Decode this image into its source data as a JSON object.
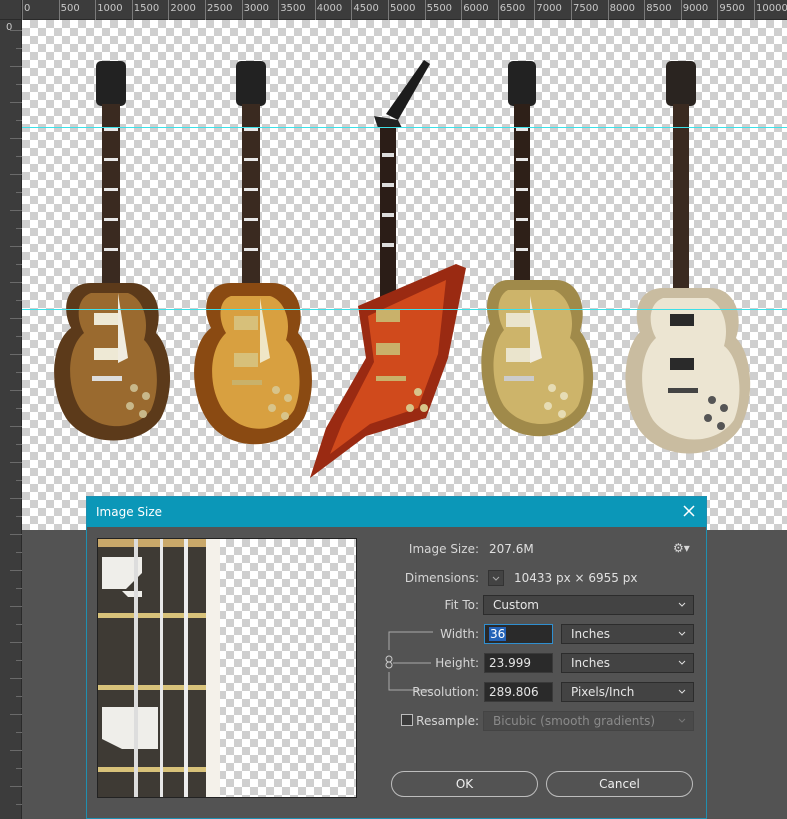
{
  "ruler": {
    "top_labels": [
      "0",
      "500",
      "1000",
      "1500",
      "2000",
      "2500",
      "3000",
      "3500",
      "4000",
      "4500",
      "5000",
      "5500",
      "6000",
      "6500",
      "7000",
      "7500",
      "8000",
      "8500",
      "9000",
      "9500",
      "10000"
    ],
    "left_origin": "0"
  },
  "dialog": {
    "title": "Image Size",
    "image_size_label": "Image Size:",
    "image_size_value": "207.6M",
    "dimensions_label": "Dimensions:",
    "dimensions_value": "10433 px  ×  6955 px",
    "fit_to_label": "Fit To:",
    "fit_to_value": "Custom",
    "width_label": "Width:",
    "width_value": "36",
    "width_unit": "Inches",
    "height_label": "Height:",
    "height_value": "23.999",
    "height_unit": "Inches",
    "resolution_label": "Resolution:",
    "resolution_value": "289.806",
    "resolution_unit": "Pixels/Inch",
    "resample_label": "Resample:",
    "resample_value": "Bicubic (smooth gradients)",
    "resample_checked": false,
    "ok_label": "OK",
    "cancel_label": "Cancel"
  },
  "colors": {
    "title_bar": "#0b97b8",
    "guide": "#3ee0e8",
    "workspace": "#535353"
  }
}
